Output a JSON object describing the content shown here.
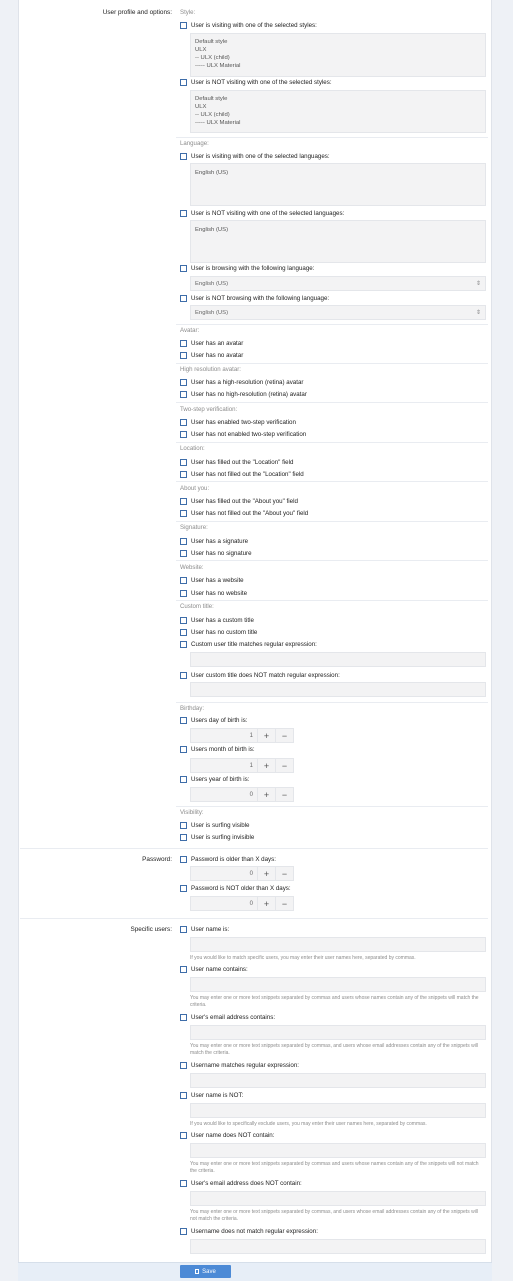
{
  "labels": {
    "user_profile": "User profile and options:",
    "password": "Password:",
    "specific_users": "Specific users:"
  },
  "style": {
    "heading": "Style:",
    "visiting": "User is visiting with one of the selected styles:",
    "not_visiting": "User is NOT visiting with one of the selected styles:",
    "options": [
      "Default style",
      "ULX",
      "-- ULX (child)",
      "----- ULX Material"
    ]
  },
  "language": {
    "heading": "Language:",
    "visiting": "User is visiting with one of the selected languages:",
    "not_visiting": "User is NOT visiting with one of the selected languages:",
    "option": "English (US)",
    "browsing": "User is browsing with the following language:",
    "not_browsing": "User is NOT browsing with the following language:",
    "select_value": "English (US)"
  },
  "avatar": {
    "heading": "Avatar:",
    "has": "User has an avatar",
    "none": "User has no avatar"
  },
  "hires": {
    "heading": "High resolution avatar:",
    "has": "User has a high-resolution (retina) avatar",
    "none": "User has no high-resolution (retina) avatar"
  },
  "twostep": {
    "heading": "Two-step verification:",
    "enabled": "User has enabled two-step verification",
    "not_enabled": "User has not enabled two-step verification"
  },
  "location": {
    "heading": "Location:",
    "filled": "User has filled out the \"Location\" field",
    "not_filled": "User has not filled out the \"Location\" field"
  },
  "about": {
    "heading": "About you:",
    "filled": "User has filled out the \"About you\" field",
    "not_filled": "User has not filled out the \"About you\" field"
  },
  "signature": {
    "heading": "Signature:",
    "has": "User has a signature",
    "none": "User has no signature"
  },
  "website": {
    "heading": "Website:",
    "has": "User has a website",
    "none": "User has no website"
  },
  "custom_title": {
    "heading": "Custom title:",
    "has": "User has a custom title",
    "none": "User has no custom title",
    "matches": "Custom user title matches regular expression:",
    "not_matches": "User custom title does NOT match regular expression:"
  },
  "birthday": {
    "heading": "Birthday:",
    "day": "Users day of birth is:",
    "day_value": "1",
    "month": "Users month of birth is:",
    "month_value": "1",
    "year": "Users year of birth is:",
    "year_value": "0"
  },
  "visibility": {
    "heading": "Visibility:",
    "visible": "User is surfing visible",
    "invisible": "User is surfing invisible"
  },
  "password": {
    "older": "Password is older than X days:",
    "older_value": "0",
    "not_older": "Password is NOT older than X days:",
    "not_older_value": "0"
  },
  "specific": {
    "name_is": "User name is:",
    "name_is_hint": "If you would like to match specific users, you may enter their user names here, separated by commas.",
    "name_contains": "User name contains:",
    "name_contains_hint": "You may enter one or more text snippets separated by commas and users whose names contain any of the snippets will match the criteria.",
    "email_contains": "User's email address contains:",
    "email_contains_hint": "You may enter one or more text snippets separated by commas, and users whose email addresses contain any of the snippets will match the criteria.",
    "regex": "Username matches regular expression:",
    "name_not": "User name is NOT:",
    "name_not_hint": "If you would like to specifically exclude users, you may enter their user names here, separated by commas.",
    "name_not_contain": "User name does NOT contain:",
    "name_not_contain_hint": "You may enter one or more text snippets separated by commas and users whose names contain any of the snippets will not match the criteria.",
    "email_not_contain": "User's email address does NOT contain:",
    "email_not_contain_hint": "You may enter one or more text snippets separated by commas, and users whose email addresses contain any of the snippets will not match the criteria.",
    "regex_not": "Username does not match regular expression:"
  },
  "stepper": {
    "plus": "+",
    "minus": "−"
  },
  "select_arrow": "⇕",
  "footer": {
    "save": "Save"
  },
  "colors": {
    "accent": "#4c8ad6",
    "checkbox_border": "#3e6da9",
    "field_bg": "#f3f3f4"
  }
}
